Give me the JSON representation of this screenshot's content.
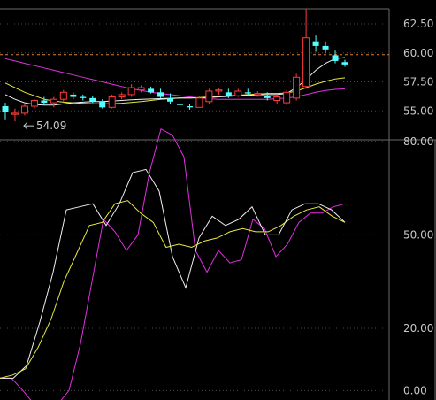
{
  "chart_data": [
    {
      "type": "candlestick",
      "y_ticks": [
        "62.50",
        "60.00",
        "57.50",
        "55.00"
      ],
      "y_tick_values": [
        62.5,
        60.0,
        57.5,
        55.0
      ],
      "ylim": [
        52.5,
        63.8
      ],
      "dashed_reference": 59.85,
      "annotation": {
        "text": "54.09",
        "value": 54.09,
        "candle": 1
      },
      "candles": [
        {
          "o": 55.4,
          "h": 55.7,
          "l": 54.2,
          "c": 54.9
        },
        {
          "o": 54.7,
          "h": 55.2,
          "l": 54.09,
          "c": 54.8
        },
        {
          "o": 54.8,
          "h": 55.6,
          "l": 54.6,
          "c": 55.4
        },
        {
          "o": 55.4,
          "h": 56.0,
          "l": 55.2,
          "c": 55.9
        },
        {
          "o": 55.9,
          "h": 56.2,
          "l": 55.5,
          "c": 55.7
        },
        {
          "o": 55.7,
          "h": 56.2,
          "l": 55.3,
          "c": 56.0
        },
        {
          "o": 56.0,
          "h": 56.8,
          "l": 55.8,
          "c": 56.6
        },
        {
          "o": 56.4,
          "h": 56.6,
          "l": 56.0,
          "c": 56.2
        },
        {
          "o": 56.2,
          "h": 56.4,
          "l": 55.9,
          "c": 56.1
        },
        {
          "o": 56.1,
          "h": 56.3,
          "l": 55.7,
          "c": 55.8
        },
        {
          "o": 55.8,
          "h": 56.0,
          "l": 55.2,
          "c": 55.3
        },
        {
          "o": 55.3,
          "h": 56.4,
          "l": 55.2,
          "c": 56.2
        },
        {
          "o": 56.2,
          "h": 56.6,
          "l": 56.0,
          "c": 56.4
        },
        {
          "o": 56.4,
          "h": 57.3,
          "l": 56.2,
          "c": 57.0
        },
        {
          "o": 56.8,
          "h": 57.2,
          "l": 56.6,
          "c": 57.0
        },
        {
          "o": 56.9,
          "h": 57.1,
          "l": 56.5,
          "c": 56.6
        },
        {
          "o": 56.6,
          "h": 56.9,
          "l": 56.1,
          "c": 56.2
        },
        {
          "o": 56.1,
          "h": 56.5,
          "l": 55.6,
          "c": 55.8
        },
        {
          "o": 55.6,
          "h": 55.8,
          "l": 55.4,
          "c": 55.5
        },
        {
          "o": 55.4,
          "h": 55.6,
          "l": 55.1,
          "c": 55.3
        },
        {
          "o": 55.3,
          "h": 56.3,
          "l": 55.3,
          "c": 56.1
        },
        {
          "o": 55.8,
          "h": 56.9,
          "l": 55.6,
          "c": 56.7
        },
        {
          "o": 56.7,
          "h": 57.0,
          "l": 56.4,
          "c": 56.8
        },
        {
          "o": 56.6,
          "h": 56.9,
          "l": 56.1,
          "c": 56.3
        },
        {
          "o": 56.3,
          "h": 56.9,
          "l": 56.2,
          "c": 56.7
        },
        {
          "o": 56.6,
          "h": 56.9,
          "l": 56.3,
          "c": 56.5
        },
        {
          "o": 56.4,
          "h": 56.7,
          "l": 56.2,
          "c": 56.5
        },
        {
          "o": 56.3,
          "h": 56.6,
          "l": 55.9,
          "c": 56.1
        },
        {
          "o": 55.9,
          "h": 56.4,
          "l": 55.6,
          "c": 56.2
        },
        {
          "o": 55.7,
          "h": 56.8,
          "l": 55.5,
          "c": 56.6
        },
        {
          "o": 56.1,
          "h": 58.2,
          "l": 55.9,
          "c": 57.9
        },
        {
          "o": 57.1,
          "h": 63.8,
          "l": 56.9,
          "c": 61.3
        },
        {
          "o": 61.0,
          "h": 61.5,
          "l": 60.1,
          "c": 60.6
        },
        {
          "o": 60.6,
          "h": 61.0,
          "l": 60.0,
          "c": 60.3
        },
        {
          "o": 59.8,
          "h": 60.2,
          "l": 59.1,
          "c": 59.3
        },
        {
          "o": 59.2,
          "h": 59.4,
          "l": 58.8,
          "c": 59.0
        }
      ],
      "series": [
        {
          "color": "#e030e0",
          "values": [
            59.5,
            59.3,
            59.1,
            58.9,
            58.7,
            58.5,
            58.3,
            58.1,
            57.9,
            57.7,
            57.5,
            57.3,
            57.1,
            56.9,
            56.75,
            56.6,
            56.5,
            56.4,
            56.3,
            56.2,
            56.1,
            56.05,
            56.0,
            56.0,
            56.0,
            56.0,
            56.0,
            56.0,
            56.05,
            56.1,
            56.2,
            56.4,
            56.6,
            56.75,
            56.85,
            56.9
          ]
        },
        {
          "color": "#e8e840",
          "values": [
            57.4,
            57.0,
            56.6,
            56.3,
            56.0,
            55.85,
            55.75,
            55.7,
            55.65,
            55.62,
            55.6,
            55.62,
            55.66,
            55.72,
            55.8,
            55.9,
            56.0,
            56.05,
            56.1,
            56.1,
            56.15,
            56.2,
            56.25,
            56.3,
            56.35,
            56.4,
            56.45,
            56.5,
            56.5,
            56.55,
            56.7,
            57.0,
            57.3,
            57.55,
            57.75,
            57.85
          ]
        },
        {
          "color": "#f0f0f0",
          "values": [
            56.4,
            56.0,
            55.7,
            55.55,
            55.5,
            55.5,
            55.6,
            55.7,
            55.75,
            55.8,
            55.8,
            55.85,
            55.9,
            55.95,
            56.0,
            56.02,
            56.05,
            56.08,
            56.1,
            56.1,
            56.12,
            56.15,
            56.2,
            56.25,
            56.3,
            56.35,
            56.38,
            56.4,
            56.4,
            56.5,
            57.0,
            57.7,
            58.5,
            59.1,
            59.5,
            59.6
          ]
        }
      ]
    },
    {
      "type": "line",
      "y_ticks": [
        "80.00",
        "50.00",
        "20.00",
        "0.00"
      ],
      "y_tick_values": [
        80,
        50,
        20,
        0
      ],
      "ylim": [
        -3,
        80.5
      ],
      "series": [
        {
          "color": "#e030e0",
          "values": [
            4,
            4,
            0,
            -4.5,
            -5,
            -4.5,
            0,
            15,
            35,
            55,
            51,
            45,
            50,
            70,
            84,
            82,
            75,
            45,
            38,
            45,
            41,
            42,
            55,
            52,
            43,
            47,
            54,
            57,
            57,
            59,
            60
          ]
        },
        {
          "color": "#f0f0f0",
          "values": [
            4,
            4,
            8,
            22,
            38,
            58,
            59,
            60,
            53,
            60,
            70,
            71,
            64,
            43,
            33,
            49,
            56,
            53,
            55,
            59,
            50,
            50,
            58,
            60,
            60,
            58,
            54
          ]
        },
        {
          "color": "#e8e840",
          "values": [
            4,
            5,
            7,
            14,
            23,
            35,
            44,
            53,
            54,
            60,
            61,
            57,
            54,
            46,
            47,
            46,
            48,
            49,
            51,
            52,
            51,
            51,
            53,
            56,
            58,
            59,
            56,
            54
          ]
        }
      ]
    }
  ]
}
